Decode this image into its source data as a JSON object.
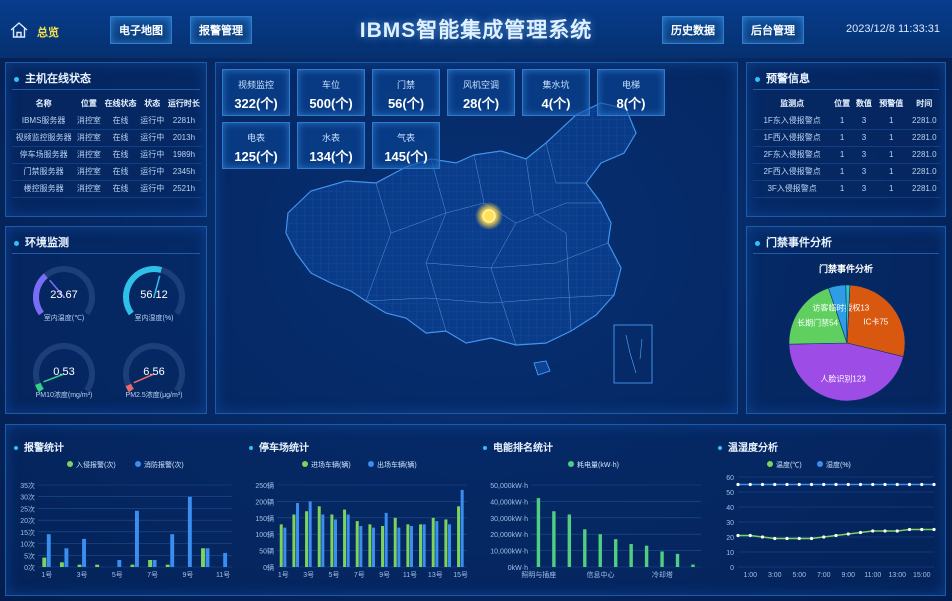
{
  "header": {
    "home_label": "总览",
    "nav_left": [
      "电子地图",
      "报警管理"
    ],
    "title": "IBMS智能集成管理系统",
    "nav_right": [
      "历史数据",
      "后台管理"
    ],
    "datetime": "2023/12/8 11:33:31"
  },
  "host_status": {
    "title": "主机在线状态",
    "columns": [
      "名称",
      "位置",
      "在线状态",
      "状态",
      "运行时长"
    ],
    "rows": [
      [
        "IBMS服务器",
        "消控室",
        "在线",
        "运行中",
        "2281h"
      ],
      [
        "视频监控服务器",
        "消控室",
        "在线",
        "运行中",
        "2013h"
      ],
      [
        "停车场服务器",
        "消控室",
        "在线",
        "运行中",
        "1989h"
      ],
      [
        "门禁服务器",
        "消控室",
        "在线",
        "运行中",
        "2345h"
      ],
      [
        "楼控服务器",
        "消控室",
        "在线",
        "运行中",
        "2521h"
      ]
    ]
  },
  "environment": {
    "title": "环境监测",
    "gauges": [
      {
        "value": "23.67",
        "label": "室内温度(℃)",
        "fraction": 0.34,
        "color": "#7b6cf6"
      },
      {
        "value": "56.12",
        "label": "室内湿度(%)",
        "fraction": 0.56,
        "color": "#2fc0e8"
      },
      {
        "value": "0.53",
        "label": "PM10浓度(mg/m³)",
        "fraction": 0.06,
        "color": "#34d08a"
      },
      {
        "value": "6.56",
        "label": "PM2.5浓度(μg/m³)",
        "fraction": 0.05,
        "color": "#e86a6a"
      }
    ]
  },
  "stats": [
    {
      "name": "视频监控",
      "value": "322(个)"
    },
    {
      "name": "车位",
      "value": "500(个)"
    },
    {
      "name": "门禁",
      "value": "56(个)"
    },
    {
      "name": "风机空调",
      "value": "28(个)"
    },
    {
      "name": "集水坑",
      "value": "4(个)"
    },
    {
      "name": "电梯",
      "value": "8(个)"
    },
    {
      "name": "电表",
      "value": "125(个)"
    },
    {
      "name": "水表",
      "value": "134(个)"
    },
    {
      "name": "气表",
      "value": "145(个)"
    }
  ],
  "alarm_info": {
    "title": "预警信息",
    "columns": [
      "监测点",
      "位置",
      "数值",
      "预警值",
      "时间"
    ],
    "rows": [
      [
        "1F东入侵报警点",
        "1",
        "3",
        "1",
        "2281.0"
      ],
      [
        "1F西入侵报警点",
        "1",
        "3",
        "1",
        "2281.0"
      ],
      [
        "2F东入侵报警点",
        "1",
        "3",
        "1",
        "2281.0"
      ],
      [
        "2F西入侵报警点",
        "1",
        "3",
        "1",
        "2281.0"
      ],
      [
        "3F入侵报警点",
        "1",
        "3",
        "1",
        "2281.0"
      ]
    ]
  },
  "access_events": {
    "title": "门禁事件分析",
    "chart_title": "门禁事件分析",
    "chart_data": {
      "type": "pie",
      "slices": [
        {
          "name": "IC卡",
          "value": 75,
          "label": "IC卡75",
          "color": "#d9580f"
        },
        {
          "name": "人脸识别",
          "value": 123,
          "label": "人脸识别123",
          "color": "#9d4de6"
        },
        {
          "name": "长期门禁",
          "value": 54,
          "label": "长期门禁54",
          "color": "#5fd05f"
        },
        {
          "name": "访客临时授权",
          "value": 13,
          "label": "访客临时授权13",
          "color": "#2f9de6"
        },
        {
          "name": "其他",
          "value": 3,
          "label": "",
          "color": "#28c7c7"
        }
      ]
    }
  },
  "charts": {
    "alarm": {
      "title": "报警统计",
      "chart_data": {
        "type": "bar",
        "categories": [
          "1号",
          "2号",
          "3号",
          "4号",
          "5号",
          "6号",
          "7号",
          "8号",
          "9号",
          "10号",
          "11号"
        ],
        "tick_labels": [
          "1号",
          "",
          "3号",
          "",
          "5号",
          "",
          "7号",
          "",
          "9号",
          "",
          "11号"
        ],
        "series": [
          {
            "name": "入侵报警(次)",
            "color": "#7ed35a",
            "values": [
              4,
              2,
              1,
              1,
              0,
              1,
              3,
              1,
              0,
              8,
              0
            ]
          },
          {
            "name": "消防报警(次)",
            "color": "#3a8ef0",
            "values": [
              14,
              8,
              12,
              0,
              3,
              24,
              3,
              14,
              30,
              8,
              6
            ]
          }
        ],
        "ylim": [
          0,
          35
        ],
        "yticks": [
          "0次",
          "5次",
          "10次",
          "15次",
          "20次",
          "25次",
          "30次",
          "35次"
        ]
      }
    },
    "parking": {
      "title": "停车场统计",
      "chart_data": {
        "type": "bar",
        "categories": [
          "1号",
          "2号",
          "3号",
          "4号",
          "5号",
          "6号",
          "7号",
          "8号",
          "9号",
          "10号",
          "11号",
          "12号",
          "13号",
          "14号",
          "15号"
        ],
        "tick_labels": [
          "1号",
          "",
          "3号",
          "",
          "5号",
          "",
          "7号",
          "",
          "9号",
          "",
          "11号",
          "",
          "13号",
          "",
          "15号"
        ],
        "series": [
          {
            "name": "进场车辆(辆)",
            "color": "#7ed35a",
            "values": [
              130,
              160,
              170,
              185,
              160,
              175,
              140,
              130,
              125,
              150,
              130,
              130,
              150,
              145,
              185
            ]
          },
          {
            "name": "出场车辆(辆)",
            "color": "#3a8ef0",
            "values": [
              120,
              195,
              200,
              160,
              145,
              160,
              125,
              120,
              165,
              120,
              125,
              130,
              140,
              130,
              235
            ]
          }
        ],
        "ylim": [
          0,
          250
        ],
        "yticks": [
          "0辆",
          "50辆",
          "100辆",
          "150辆",
          "200辆",
          "250辆"
        ]
      }
    },
    "energy": {
      "title": "电能排名统计",
      "chart_data": {
        "type": "bar",
        "categories": [
          "照明与插座",
          "",
          "信息中心",
          "",
          "冷却塔",
          "",
          "",
          "",
          "",
          "",
          ""
        ],
        "tick_labels": [
          "照明与插座",
          "",
          "信息中心",
          "",
          "冷却塔"
        ],
        "series": [
          {
            "name": "耗电量(kW·h)",
            "color": "#4fcf7f",
            "values": [
              42000,
              34000,
              32000,
              23000,
              20000,
              17000,
              14000,
              13000,
              9500,
              8000,
              1500
            ]
          }
        ],
        "ylim": [
          0,
          50000
        ],
        "yticks": [
          "0kW·h",
          "10,000kW·h",
          "20,000kW·h",
          "30,000kW·h",
          "40,000kW·h",
          "50,000kW·h"
        ]
      }
    },
    "temp_humidity": {
      "title": "温湿度分析",
      "chart_data": {
        "type": "line",
        "x": [
          "0:00",
          "1:00",
          "2:00",
          "3:00",
          "4:00",
          "5:00",
          "6:00",
          "7:00",
          "8:00",
          "9:00",
          "10:00",
          "11:00",
          "12:00",
          "13:00",
          "14:00",
          "15:00",
          "16:00"
        ],
        "tick_labels": [
          "1:00",
          "3:00",
          "5:00",
          "7:00",
          "9:00",
          "11:00",
          "13:00",
          "15:00"
        ],
        "series": [
          {
            "name": "温度(℃)",
            "color": "#7ed35a",
            "values": [
              21,
              21,
              20,
              19,
              19,
              19,
              19,
              20,
              21,
              22,
              23,
              24,
              24,
              24,
              25,
              25,
              25
            ]
          },
          {
            "name": "湿度(%)",
            "color": "#3a8ef0",
            "values": [
              55,
              55,
              55,
              55,
              55,
              55,
              55,
              55,
              55,
              55,
              55,
              55,
              55,
              55,
              55,
              55,
              55
            ]
          }
        ],
        "ylim": [
          0,
          60
        ],
        "yticks": [
          "0",
          "10",
          "20",
          "30",
          "40",
          "50",
          "60"
        ]
      }
    }
  }
}
